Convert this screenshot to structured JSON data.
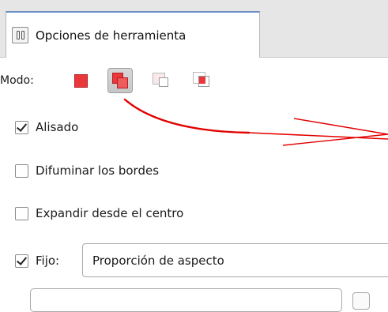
{
  "panel_tab": {
    "label": "Opciones de herramienta",
    "icon": "tool-options-icon"
  },
  "mode": {
    "label": "Modo:",
    "buttons": [
      {
        "name": "replace-selection-mode",
        "icon": "replace-mode-icon",
        "pressed": false
      },
      {
        "name": "add-to-selection-mode",
        "icon": "add-mode-icon",
        "pressed": true
      },
      {
        "name": "subtract-from-selection-mode",
        "icon": "subtract-mode-icon",
        "pressed": false
      },
      {
        "name": "intersect-selection-mode",
        "icon": "intersect-mode-icon",
        "pressed": false
      }
    ]
  },
  "options": {
    "antialiasing": {
      "label": "Alisado",
      "checked": true
    },
    "feather_edges": {
      "label": "Difuminar los bordes",
      "checked": false
    },
    "expand_from_center": {
      "label": "Expandir desde el centro",
      "checked": false
    },
    "fixed": {
      "label": "Fijo:",
      "checked": true,
      "value": "Proporción de aspecto"
    }
  },
  "colors": {
    "selection_red": "#e8383b",
    "annotation_arrow": "#e30000",
    "tab_accent": "#6b8ec5"
  }
}
